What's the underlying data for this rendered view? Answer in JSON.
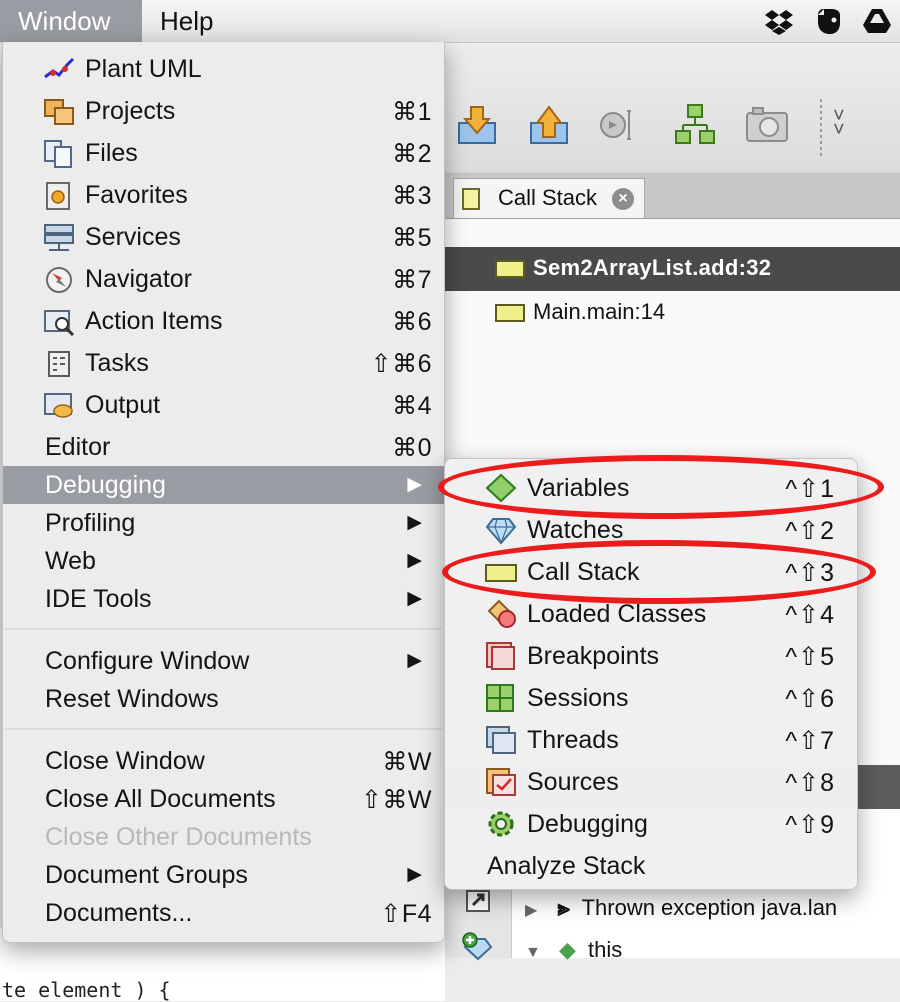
{
  "menubar": {
    "window": "Window",
    "help": "Help",
    "tray_icons": [
      "dropbox-icon",
      "evernote-icon",
      "google-drive-icon"
    ]
  },
  "ide": {
    "tab_label": "Call Stack",
    "call_stack": [
      "Sem2ArrayList.add:32",
      "Main.main:14"
    ],
    "variables": [
      "Thrown exception java.lan",
      "this"
    ],
    "editor_fragment": "te element ) {"
  },
  "window_menu": {
    "items": [
      {
        "label": "Plant UML",
        "shortcut": "",
        "icon": "plant-uml-icon"
      },
      {
        "label": "Projects",
        "shortcut": "⌘1",
        "icon": "projects-icon"
      },
      {
        "label": "Files",
        "shortcut": "⌘2",
        "icon": "files-icon"
      },
      {
        "label": "Favorites",
        "shortcut": "⌘3",
        "icon": "favorites-icon"
      },
      {
        "label": "Services",
        "shortcut": "⌘5",
        "icon": "services-icon"
      },
      {
        "label": "Navigator",
        "shortcut": "⌘7",
        "icon": "navigator-icon"
      },
      {
        "label": "Action Items",
        "shortcut": "⌘6",
        "icon": "action-items-icon"
      },
      {
        "label": "Tasks",
        "shortcut": "⇧⌘6",
        "icon": "tasks-icon"
      },
      {
        "label": "Output",
        "shortcut": "⌘4",
        "icon": "output-icon"
      },
      {
        "label": "Editor",
        "shortcut": "⌘0"
      },
      {
        "label": "Debugging",
        "submenu": true,
        "highlighted": true
      },
      {
        "label": "Profiling",
        "submenu": true
      },
      {
        "label": "Web",
        "submenu": true
      },
      {
        "label": "IDE Tools",
        "submenu": true
      },
      {
        "label": "Configure Window",
        "submenu": true
      },
      {
        "label": "Reset Windows",
        "shortcut": ""
      },
      {
        "label": "Close Window",
        "shortcut": "⌘W"
      },
      {
        "label": "Close All Documents",
        "shortcut": "⇧⌘W"
      },
      {
        "label": "Close Other Documents",
        "shortcut": "",
        "disabled": true
      },
      {
        "label": "Document Groups",
        "submenu": true
      },
      {
        "label": "Documents...",
        "shortcut": "⇧F4"
      }
    ],
    "submenu_arrow": "▶"
  },
  "debugging_menu": {
    "items": [
      {
        "label": "Variables",
        "shortcut": "^⇧1",
        "icon": "variables-icon"
      },
      {
        "label": "Watches",
        "shortcut": "^⇧2",
        "icon": "watches-icon"
      },
      {
        "label": "Call Stack",
        "shortcut": "^⇧3",
        "icon": "call-stack-icon"
      },
      {
        "label": "Loaded Classes",
        "shortcut": "^⇧4",
        "icon": "loaded-classes-icon"
      },
      {
        "label": "Breakpoints",
        "shortcut": "^⇧5",
        "icon": "breakpoints-icon"
      },
      {
        "label": "Sessions",
        "shortcut": "^⇧6",
        "icon": "sessions-icon"
      },
      {
        "label": "Threads",
        "shortcut": "^⇧7",
        "icon": "threads-icon"
      },
      {
        "label": "Sources",
        "shortcut": "^⇧8",
        "icon": "sources-icon"
      },
      {
        "label": "Debugging",
        "shortcut": "^⇧9",
        "icon": "debugging-gear-icon"
      },
      {
        "label": "Analyze Stack",
        "shortcut": ""
      }
    ]
  },
  "colors": {
    "highlight": "#9a9ca3",
    "annotation": "#ec1c1c",
    "selected_row": "#4a4a4a"
  }
}
